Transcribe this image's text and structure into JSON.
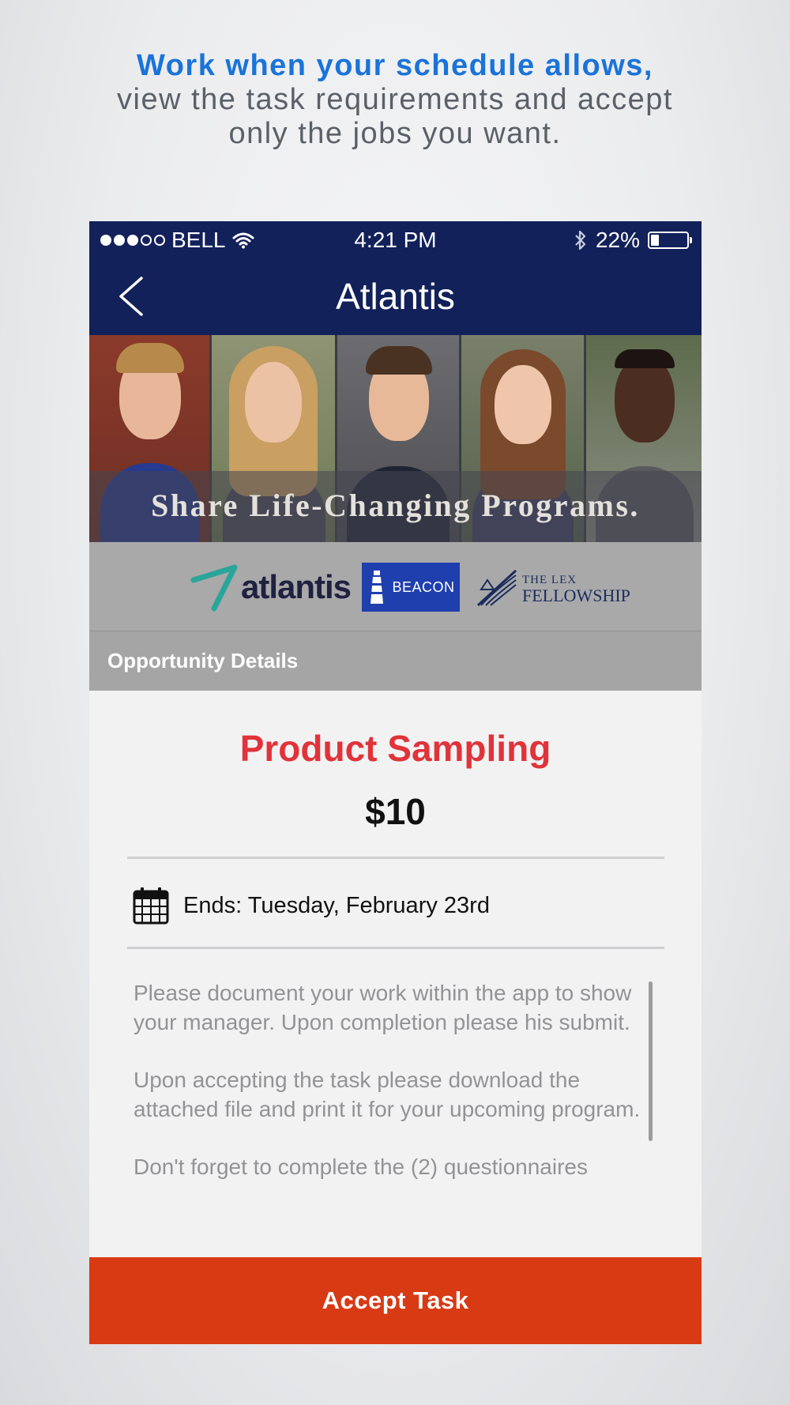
{
  "promo": {
    "headline_accent": "Work when your schedule allows,",
    "headline_line2": "view the task requirements and accept",
    "headline_line3": "only the jobs you want."
  },
  "status_bar": {
    "carrier": "BELL",
    "time": "4:21 PM",
    "battery": "22%",
    "battery_level": 0.22
  },
  "nav": {
    "title": "Atlantis",
    "back_icon": "chevron-left-icon"
  },
  "banner": {
    "tagline": "Share Life-Changing Programs."
  },
  "logos": {
    "atlantis": "atlantis",
    "beacon": "BEACON",
    "lex_line1": "THE LEX",
    "lex_line2": "FELLOWSHIP"
  },
  "section": {
    "title": "Opportunity Details"
  },
  "task": {
    "title": "Product Sampling",
    "price": "$10",
    "ends": "Ends: Tuesday, February 23rd",
    "description": [
      "Please document your work within the app to show your manager. Upon completion please his submit.",
      "Upon accepting the task please download the attached file and print it for your upcoming program.",
      "Don't forget to complete the (2) questionnaires"
    ]
  },
  "actions": {
    "accept_label": "Accept Task"
  },
  "colors": {
    "nav_bg": "#12215a",
    "accent_blue": "#1a73d9",
    "task_title_red": "#e0333a",
    "accept_bg": "#d83a14"
  }
}
